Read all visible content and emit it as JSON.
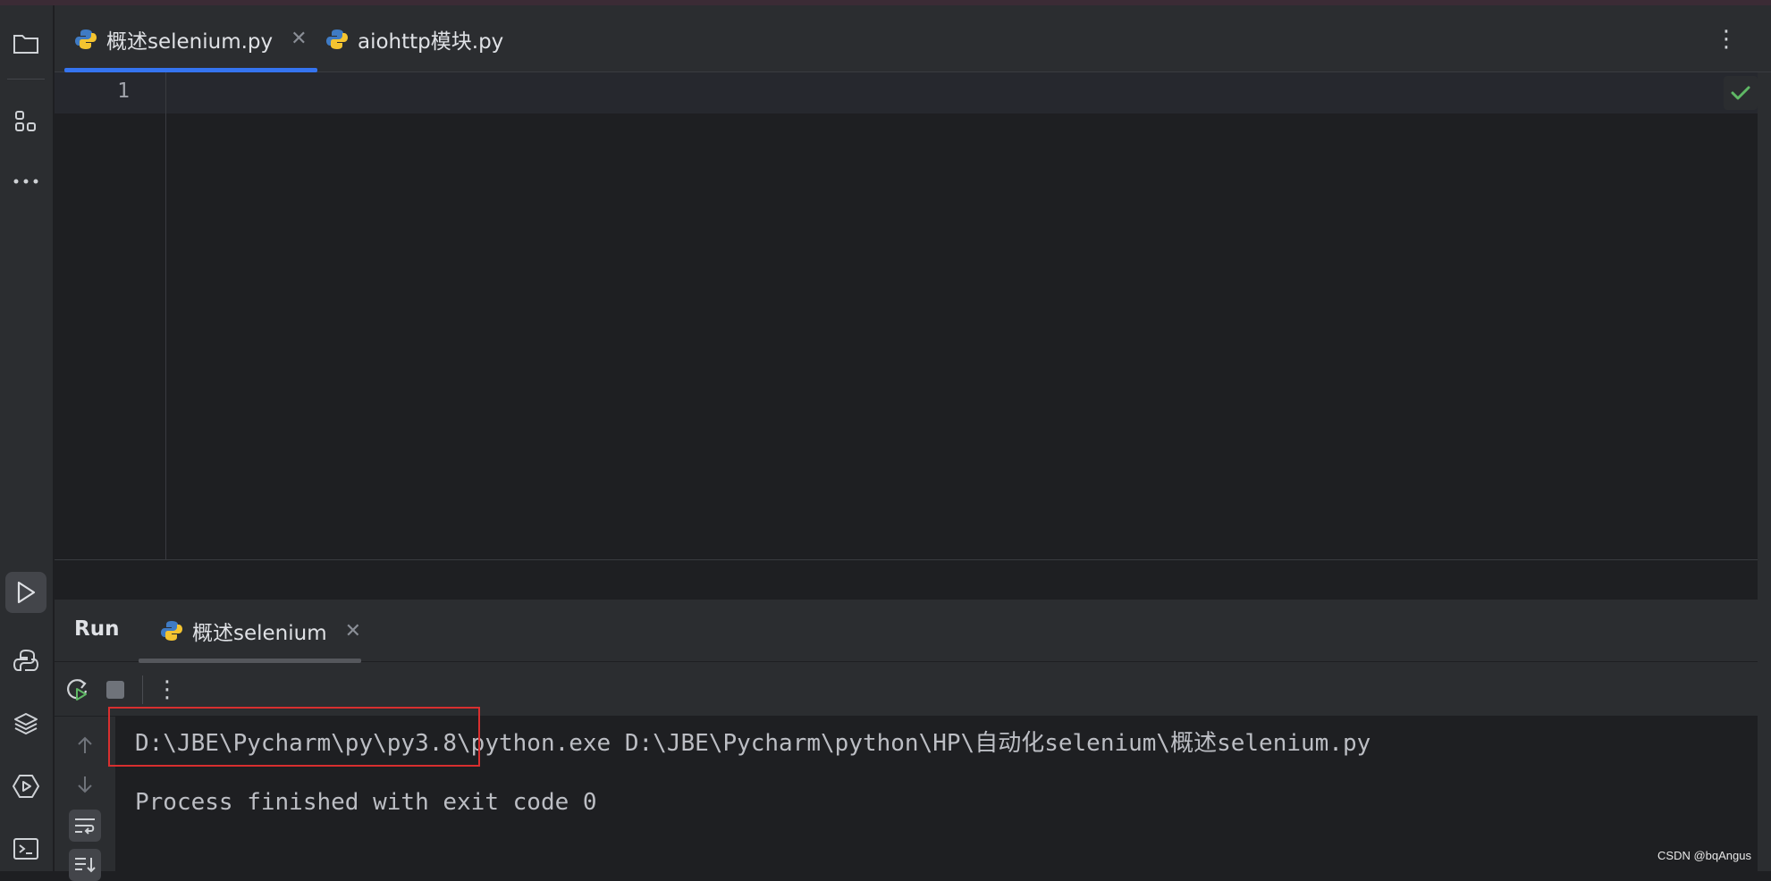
{
  "editor_tabs": [
    {
      "label": "概述selenium.py",
      "icon": "python-icon",
      "active": true,
      "closable": true
    },
    {
      "label": "aiohttp模块.py",
      "icon": "python-icon",
      "active": false,
      "closable": false
    }
  ],
  "editor": {
    "line_numbers": [
      "1"
    ],
    "inspection_status": "check-icon"
  },
  "sidebar": {
    "items": [
      "project-folder-icon",
      "structure-icon",
      "more-icon",
      "run-icon",
      "python-console-icon",
      "layers-icon",
      "services-icon",
      "terminal-icon"
    ]
  },
  "run_panel": {
    "title": "Run",
    "tab_label": "概述selenium",
    "toolbar": [
      "rerun-icon",
      "stop-icon",
      "more-vertical-icon"
    ],
    "console_lines": [
      "D:\\JBE\\Pycharm\\py\\py3.8\\python.exe D:\\JBE\\Pycharm\\python\\HP\\自动化selenium\\概述selenium.py",
      "",
      "Process finished with exit code 0"
    ]
  },
  "watermark": "CSDN @bqAngus",
  "colors": {
    "accent": "#3574f0",
    "highlight_box": "#d82f2f",
    "success": "#5fb865"
  }
}
